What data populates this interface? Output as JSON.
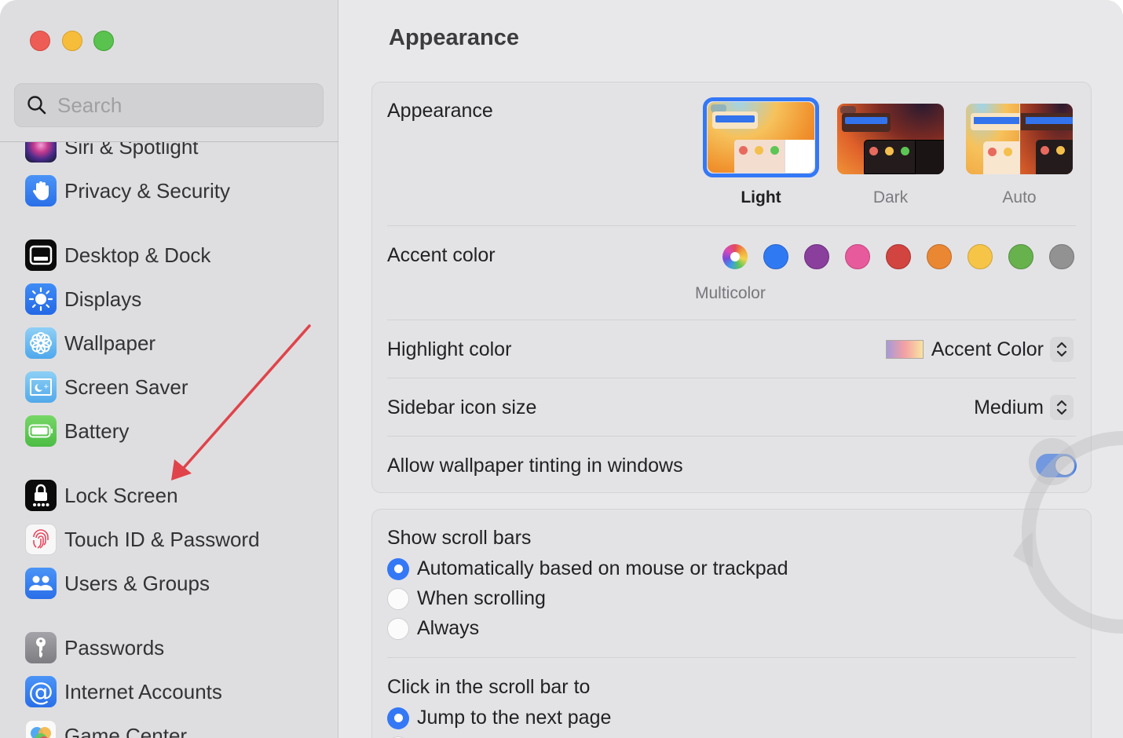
{
  "window": {
    "controls": {
      "close": "close",
      "minimize": "minimize",
      "zoom": "zoom"
    }
  },
  "sidebar": {
    "search": {
      "placeholder": "Search",
      "value": ""
    },
    "items": [
      {
        "label": "Siri & Spotlight",
        "icon": "siri-icon"
      },
      {
        "label": "Privacy & Security",
        "icon": "hand-icon"
      },
      {
        "label": "Desktop & Dock",
        "icon": "dock-icon"
      },
      {
        "label": "Displays",
        "icon": "sun-icon"
      },
      {
        "label": "Wallpaper",
        "icon": "flower-icon"
      },
      {
        "label": "Screen Saver",
        "icon": "screen-saver-icon"
      },
      {
        "label": "Battery",
        "icon": "battery-icon"
      },
      {
        "label": "Lock Screen",
        "icon": "lock-icon"
      },
      {
        "label": "Touch ID & Password",
        "icon": "fingerprint-icon"
      },
      {
        "label": "Users & Groups",
        "icon": "users-icon"
      },
      {
        "label": "Passwords",
        "icon": "key-icon"
      },
      {
        "label": "Internet Accounts",
        "icon": "at-icon"
      },
      {
        "label": "Game Center",
        "icon": "game-center-icon"
      }
    ]
  },
  "main": {
    "title": "Appearance",
    "appearance": {
      "label": "Appearance",
      "options": [
        {
          "label": "Light",
          "selected": true
        },
        {
          "label": "Dark",
          "selected": false
        },
        {
          "label": "Auto",
          "selected": false
        }
      ]
    },
    "accent": {
      "label": "Accent color",
      "selected_label": "Multicolor",
      "colors": [
        {
          "name": "Multicolor",
          "hex": "multicolor"
        },
        {
          "name": "Blue",
          "hex": "#2f7af3"
        },
        {
          "name": "Purple",
          "hex": "#8a3f9c"
        },
        {
          "name": "Pink",
          "hex": "#e75a9b"
        },
        {
          "name": "Red",
          "hex": "#d2443f"
        },
        {
          "name": "Orange",
          "hex": "#ea8733"
        },
        {
          "name": "Yellow",
          "hex": "#f6c548"
        },
        {
          "name": "Green",
          "hex": "#68b24e"
        },
        {
          "name": "Graphite",
          "hex": "#929292"
        }
      ]
    },
    "highlight": {
      "label": "Highlight color",
      "value": "Accent Color"
    },
    "sidebar_icon_size": {
      "label": "Sidebar icon size",
      "value": "Medium"
    },
    "wallpaper_tinting": {
      "label": "Allow wallpaper tinting in windows",
      "enabled": true
    },
    "scroll_bars": {
      "label": "Show scroll bars",
      "options": [
        {
          "label": "Automatically based on mouse or trackpad",
          "selected": true
        },
        {
          "label": "When scrolling",
          "selected": false
        },
        {
          "label": "Always",
          "selected": false
        }
      ]
    },
    "click_scroll": {
      "label": "Click in the scroll bar to",
      "options": [
        {
          "label": "Jump to the next page",
          "selected": true
        }
      ]
    }
  },
  "colors": {
    "accent": "#3478f6",
    "annotation_arrow": "#e0434a"
  }
}
